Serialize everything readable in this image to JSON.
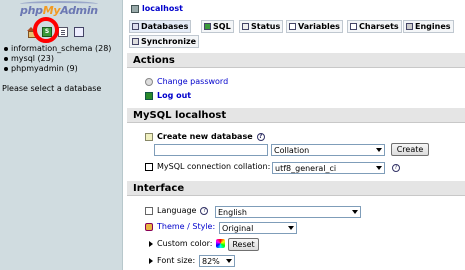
{
  "nav": {
    "logo": {
      "php": "php",
      "my": "My",
      "admin": "Admin"
    },
    "icons": [
      "home-icon",
      "query-window-icon",
      "documentation-icon",
      "help-icon"
    ],
    "databases": [
      {
        "name": "information_schema",
        "count": "(28)"
      },
      {
        "name": "mysql",
        "count": "(23)"
      },
      {
        "name": "phpmyadmin",
        "count": "(9)"
      }
    ],
    "message": "Please select a database"
  },
  "server": {
    "name": "localhost"
  },
  "tabs": [
    {
      "label": "Databases"
    },
    {
      "label": "SQL"
    },
    {
      "label": "Status"
    },
    {
      "label": "Variables"
    },
    {
      "label": "Charsets"
    },
    {
      "label": "Engines"
    },
    {
      "label": "Synchronize"
    }
  ],
  "actions": {
    "title": "Actions",
    "change_password": "Change password",
    "log_out": "Log out"
  },
  "mysql": {
    "title": "MySQL localhost",
    "create_db_label": "Create new database",
    "collation_placeholder": "Collation",
    "create_button": "Create",
    "connection_collation_label": "MySQL connection collation:",
    "connection_collation_value": "utf8_general_ci"
  },
  "interface": {
    "title": "Interface",
    "language_label": "Language",
    "language_value": "English",
    "theme_label": "Theme / Style:",
    "theme_value": "Original",
    "custom_color_label": "Custom color:",
    "reset_button": "Reset",
    "font_size_label": "Font size:",
    "font_size_value": "82%"
  },
  "colors": {
    "nav_background": "#d0dce0",
    "link": "#0000cc",
    "highlight_ring": "#ff0000"
  }
}
